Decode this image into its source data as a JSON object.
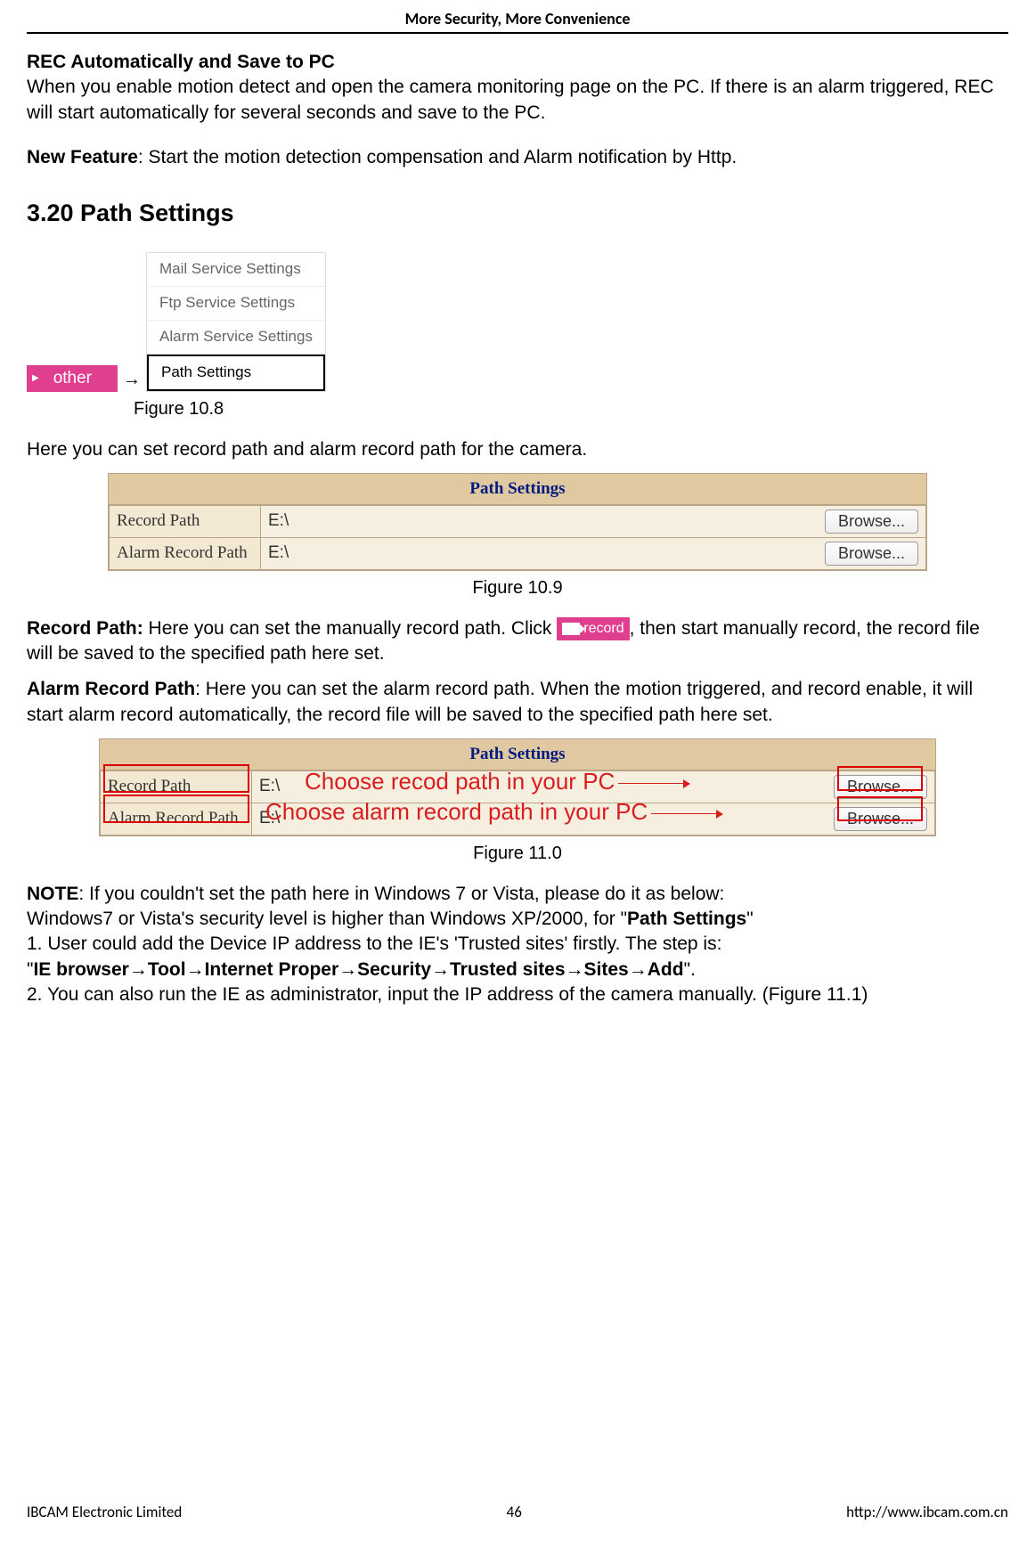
{
  "header": {
    "title": "More Security, More Convenience"
  },
  "section_rec": {
    "heading": "REC Automatically and Save to PC",
    "body": "When you enable motion detect and open the camera monitoring page on the PC. If there is an alarm triggered, REC will start automatically for several seconds and save to the PC.",
    "new_feature_label": "New Feature",
    "new_feature_text": ": Start the motion detection compensation and Alarm notification by Http."
  },
  "section_path": {
    "heading": "3.20 Path Settings",
    "other_label": "other",
    "arrow": "→",
    "menu_items": [
      "Mail Service Settings",
      "Ftp Service Settings",
      "Alarm Service Settings",
      "Path Settings"
    ],
    "fig108": "Figure 10.8",
    "intro": "Here you can set record path and alarm record path for the camera.",
    "table1": {
      "title": "Path Settings",
      "rows": [
        {
          "label": "Record Path",
          "value": "E:\\",
          "button": "Browse..."
        },
        {
          "label": "Alarm Record Path",
          "value": "E:\\",
          "button": "Browse..."
        }
      ]
    },
    "fig109": "Figure 10.9",
    "record_path_label": "Record Path:",
    "record_path_text1": " Here you can set the manually record path. Click",
    "record_chip_text": "record",
    "record_path_text2": ", then start manually record, the record file will be saved to the specified path here set.",
    "alarm_path_label": "Alarm Record Path",
    "alarm_path_text": ": Here you can set the alarm record path. When the motion triggered, and record enable, it will start alarm record automatically, the record file will be saved to the specified path here set.",
    "table2": {
      "title": "Path Settings",
      "rows": [
        {
          "label": "Record Path",
          "value": "E:\\",
          "button": "Browse..."
        },
        {
          "label": "Alarm Record Path",
          "value": "E:\\",
          "button": "Browse..."
        }
      ],
      "overlay1": "Choose recod path in your PC",
      "overlay2": "Choose alarm record path in your PC"
    },
    "fig110": "Figure 11.0",
    "note_label": "NOTE",
    "note1": ": If you couldn't set the path here in Windows 7 or Vista, please do it as below:",
    "note2_a": "Windows7 or Vista's security level is higher than Windows XP/2000, for \"",
    "note2_b": "Path Settings",
    "note2_c": "\"",
    "step1": "1. User could add the Device IP address to the IE's 'Trusted sites' firstly. The step is:",
    "step1b_a": "\"",
    "step1b_b": "IE browser→Tool→Internet Proper→Security→Trusted sites→Sites→Add",
    "step1b_c": "\".",
    "step2": "2. You can also run the IE as administrator, input the IP address of the camera manually. (Figure 11.1)"
  },
  "footer": {
    "company": "IBCAM Electronic Limited",
    "page": "46",
    "url": "http://www.ibcam.com.cn"
  }
}
